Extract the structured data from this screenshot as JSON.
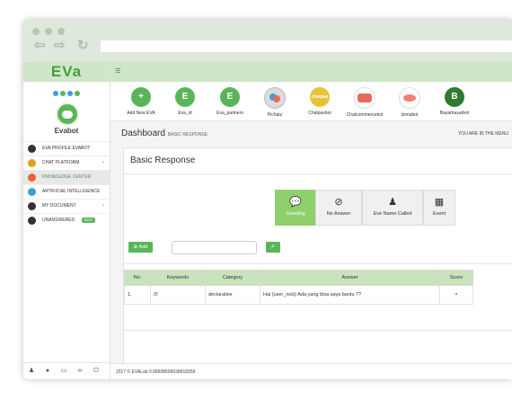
{
  "app": {
    "logo_text": "EVa",
    "bot_name": "Evabot"
  },
  "sidebar": {
    "items": [
      {
        "label": "EVA PROFILE EVABOT",
        "icon": "user-icon",
        "color": "#333333",
        "arrow": ""
      },
      {
        "label": "CHAT PLATFORM",
        "icon": "chat-icon",
        "color": "#e0a020",
        "arrow": "›"
      },
      {
        "label": "KNOWLEDGE CENTER",
        "icon": "knowledge-icon",
        "color": "#f06030",
        "arrow": ""
      },
      {
        "label": "ARTIFICIAL INTELLIGENCE",
        "icon": "brain-icon",
        "color": "#3aa0d8",
        "arrow": ""
      },
      {
        "label": "MY DOCUMENT",
        "icon": "document-icon",
        "color": "#333333",
        "arrow": "›"
      },
      {
        "label": "UNANSWERED",
        "icon": "question-icon",
        "color": "#333333",
        "badge": "NEW"
      }
    ]
  },
  "bots": [
    {
      "initial": "+",
      "label": "Add New EVA",
      "color": "#5ab55a"
    },
    {
      "initial": "E",
      "label": "Eva_id",
      "color": "#5ab55a"
    },
    {
      "initial": "E",
      "label": "Eva_partners",
      "color": "#5ab55a"
    },
    {
      "initial": "",
      "label": "Pichatz",
      "color": "#dcdcdc"
    },
    {
      "initial": "chatpas",
      "label": "Chatpasbot",
      "color": "#e8c23a"
    },
    {
      "initial": "",
      "label": "Chatcommercebot",
      "color": "#e86a5a"
    },
    {
      "initial": "",
      "label": "Izimabot",
      "color": "#f08070"
    },
    {
      "initial": "B",
      "label": "Bayarbayarbot",
      "color": "#2f7a2f"
    }
  ],
  "breadcrumb": {
    "title": "Dashboard",
    "subtitle": "BASIC RESPONSE",
    "location": "YOU ARE IN THE MENU"
  },
  "panel": {
    "title": "Basic Response"
  },
  "tabs": [
    {
      "label": "Greeting",
      "icon": "chat-icon",
      "glyph": "💬"
    },
    {
      "label": "No Answer",
      "icon": "ban-icon",
      "glyph": "⊘"
    },
    {
      "label": "Eve Name Called",
      "icon": "person-icon",
      "glyph": "♟"
    },
    {
      "label": "Event",
      "icon": "calendar-icon",
      "glyph": "▦"
    }
  ],
  "toolbar": {
    "add_label": "Add",
    "search_placeholder": ""
  },
  "table": {
    "headers": [
      "No.",
      "Keywords",
      "Category",
      "Answer",
      "Score"
    ],
    "rows": [
      {
        "no": "1.",
        "keywords": "/0",
        "category": "declarative",
        "answer": "Hai {user_nick} Ada yang bisa saya bantu ??",
        "score": "×"
      }
    ]
  },
  "footer": {
    "text": "2017 © EVALab 0.68908596038818359"
  },
  "colors": {
    "brand": "#5ab55a",
    "brand_light": "#cfe6c8",
    "header_row": "#c9e3bd"
  }
}
